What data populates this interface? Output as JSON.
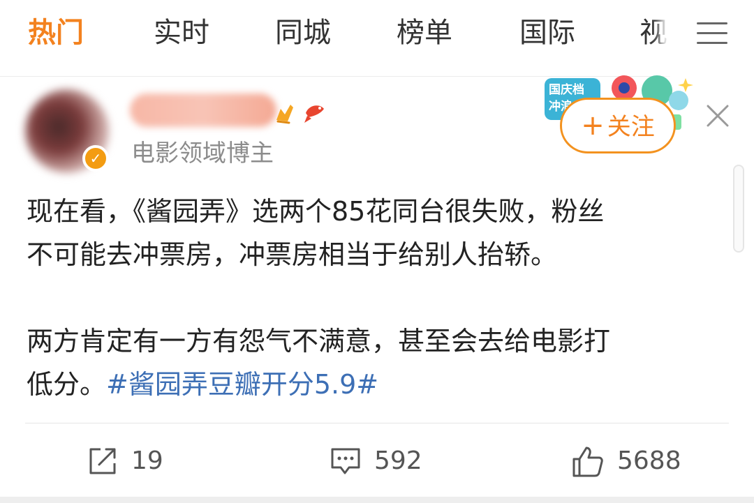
{
  "nav": {
    "tabs": [
      "热门",
      "实时",
      "同城",
      "榜单",
      "国际",
      "视"
    ],
    "active_index": 0,
    "menu_icon": "hamburger-menu-icon"
  },
  "post": {
    "author_role": "电影领域博主",
    "promo_sticker_text": [
      "国庆档",
      "冲浪"
    ],
    "follow_label": "关注",
    "content": {
      "paragraph1_line1": "现在看，《酱园弄》选两个85花同台很失败，粉丝",
      "paragraph1_line2": "不可能去冲票房，冲票房相当于给别人抬轿。",
      "paragraph2_line1": "两方肯定有一方有怨气不满意，甚至会去给电影打",
      "paragraph2_line2_text": "低分。",
      "hashtag": "#酱园弄豆瓣开分5.9#"
    },
    "actions": {
      "repost_count": "19",
      "comment_count": "592",
      "like_count": "5688"
    }
  },
  "colors": {
    "accent": "#f3821f",
    "hashtag": "#3d6fb5",
    "verified": "#f39c12"
  }
}
